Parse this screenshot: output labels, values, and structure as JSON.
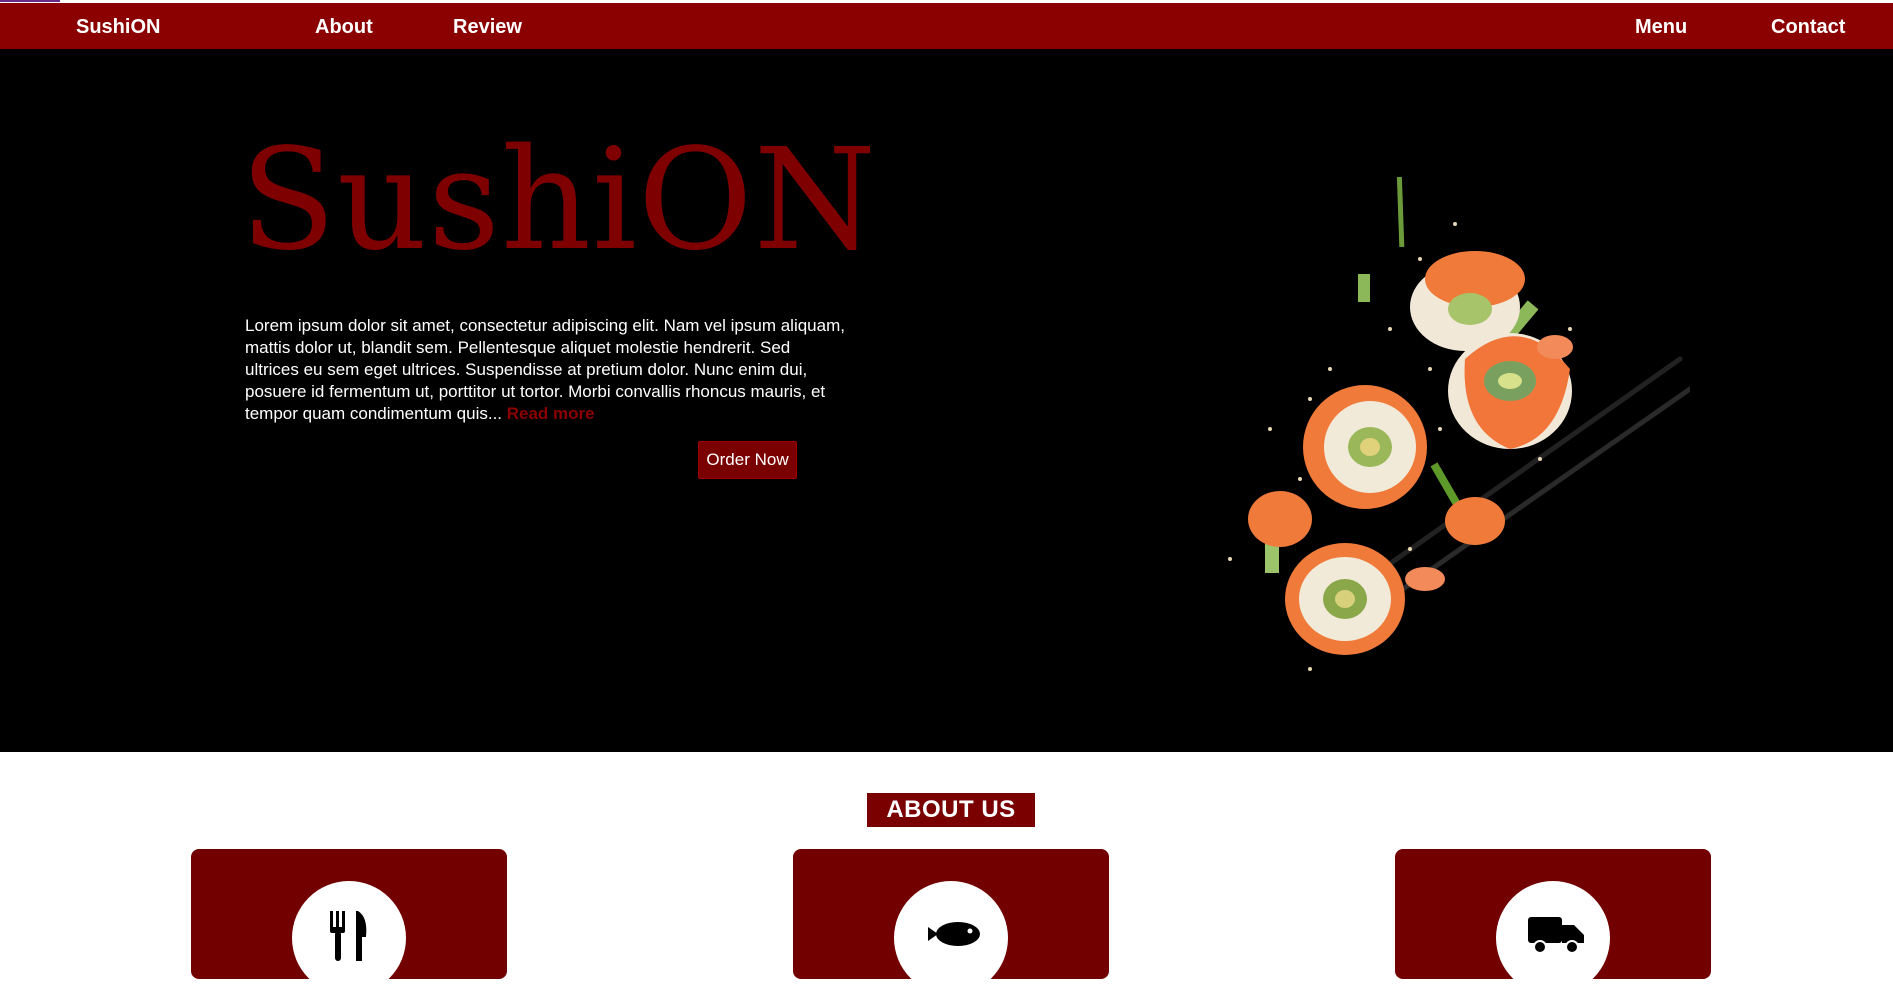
{
  "nav": {
    "brand": "SushiON",
    "about": "About",
    "review": "Review",
    "menu": "Menu",
    "contact": "Contact"
  },
  "hero": {
    "title": "SushiON",
    "text": "Lorem ipsum dolor sit amet, consectetur adipiscing elit. Nam vel ipsum aliquam, mattis dolor ut, blandit sem. Pellentesque aliquet molestie hendrerit. Sed ultrices eu sem eget ultrices. Suspendisse at pretium dolor. Nunc enim dui, posuere id fermentum ut, porttitor ut tortor. Morbi convallis rhoncus mauris, et tempor quam condimentum quis...",
    "read_more": "Read more",
    "order_button": "Order Now"
  },
  "about": {
    "heading": "ABOUT US",
    "cards": [
      {
        "icon": "utensils-icon"
      },
      {
        "icon": "fish-icon"
      },
      {
        "icon": "truck-icon"
      }
    ]
  },
  "colors": {
    "brand_red": "#8b0000",
    "card_red": "#720000",
    "hero_bg": "#000000"
  }
}
